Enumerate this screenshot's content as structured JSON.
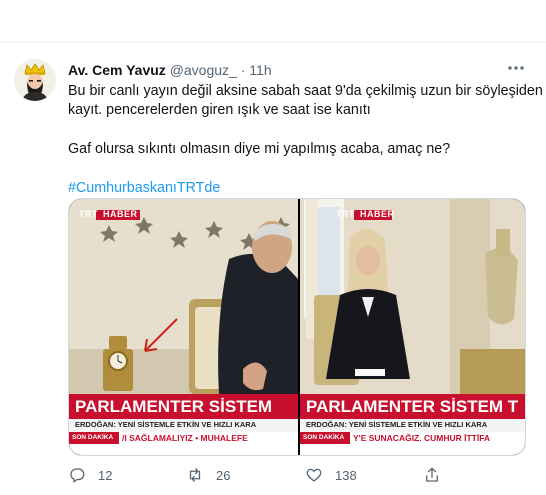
{
  "tweet": {
    "author_name": "Av. Cem Yavuz",
    "handle": "@avoguz_",
    "separator": "·",
    "time": "11h",
    "text_lines": [
      "Bu bir canlı yayın değil aksine sabah saat 9'da çekilmiş uzun bir söyleşiden",
      "kayıt. pencerelerden giren ışık ve saat ise kanıtı",
      "Gaf olursa sıkıntı olmasın diye mi yapılmış acaba, amaç ne?"
    ],
    "hashtag": "#CumhurbaskanıTRTde"
  },
  "media": {
    "left": {
      "logo_prefix": "TRT",
      "logo_badge": "HABER",
      "banner_title": "PARLAMENTER SİSTEM",
      "banner_sub": "ERDOĞAN: YENİ SİSTEMLE ETKİN VE HIZLI KARA",
      "ticker_badge": "SON DAKİKA",
      "ticker_text": "/I SAĞLAMALIYIZ  •  MUHALEFE"
    },
    "right": {
      "logo_prefix": "TRT",
      "logo_badge": "HABER",
      "banner_title": "PARLAMENTER SİSTEM T",
      "banner_sub": "ERDOĞAN: YENİ SİSTEMLE ETKİN VE HIZLI KARA",
      "ticker_badge": "SON DAKİKA",
      "ticker_text": "Y'E SUNACAĞIZ. CUMHUR İTTİFA"
    }
  },
  "actions": {
    "reply_count": "12",
    "retweet_count": "26",
    "like_count": "138"
  },
  "colors": {
    "accent": "#1d9bf0",
    "secondary_text": "#536471",
    "trt_red": "#c8102e"
  }
}
